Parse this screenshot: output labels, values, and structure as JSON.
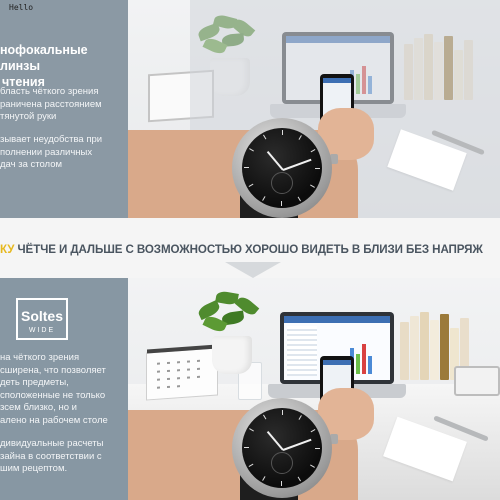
{
  "caption": "Hello",
  "top": {
    "title_lines": [
      "нофокальные линзы",
      "чтения"
    ],
    "para1_lines": [
      "бласть чёткого зрения",
      "раничена расстоянием",
      "тянутой руки"
    ],
    "para2_lines": [
      "зывает неудобства при",
      "полнении различных",
      "дач за столом"
    ]
  },
  "band": {
    "highlight": "КУ",
    "text": " ЧЁТЧЕ И ДАЛЬШЕ С ВОЗМОЖНОСТЬЮ ХОРОШО ВИДЕТЬ В БЛИЗИ БЕЗ НАПРЯЖ"
  },
  "bottom": {
    "logo_name": "Soltes",
    "logo_sub": "WIDE",
    "para1_lines": [
      "на чёткого зрения",
      "сширена, что позволяет",
      "деть предметы,",
      "сположенные не только",
      "зсем близко, но и",
      "алено на рабочем столе"
    ],
    "para2_lines": [
      "дивидуальные расчеты",
      "зайна в соответствии с",
      "шим рецептом."
    ]
  },
  "icons": {
    "logo": "soltes-logo",
    "arrow": "down-arrow-icon"
  },
  "colors": {
    "sidebar": "#8797a3",
    "highlight": "#e6b81e",
    "band_text": "#4a5560",
    "band_bg": "#f5f5f5"
  }
}
